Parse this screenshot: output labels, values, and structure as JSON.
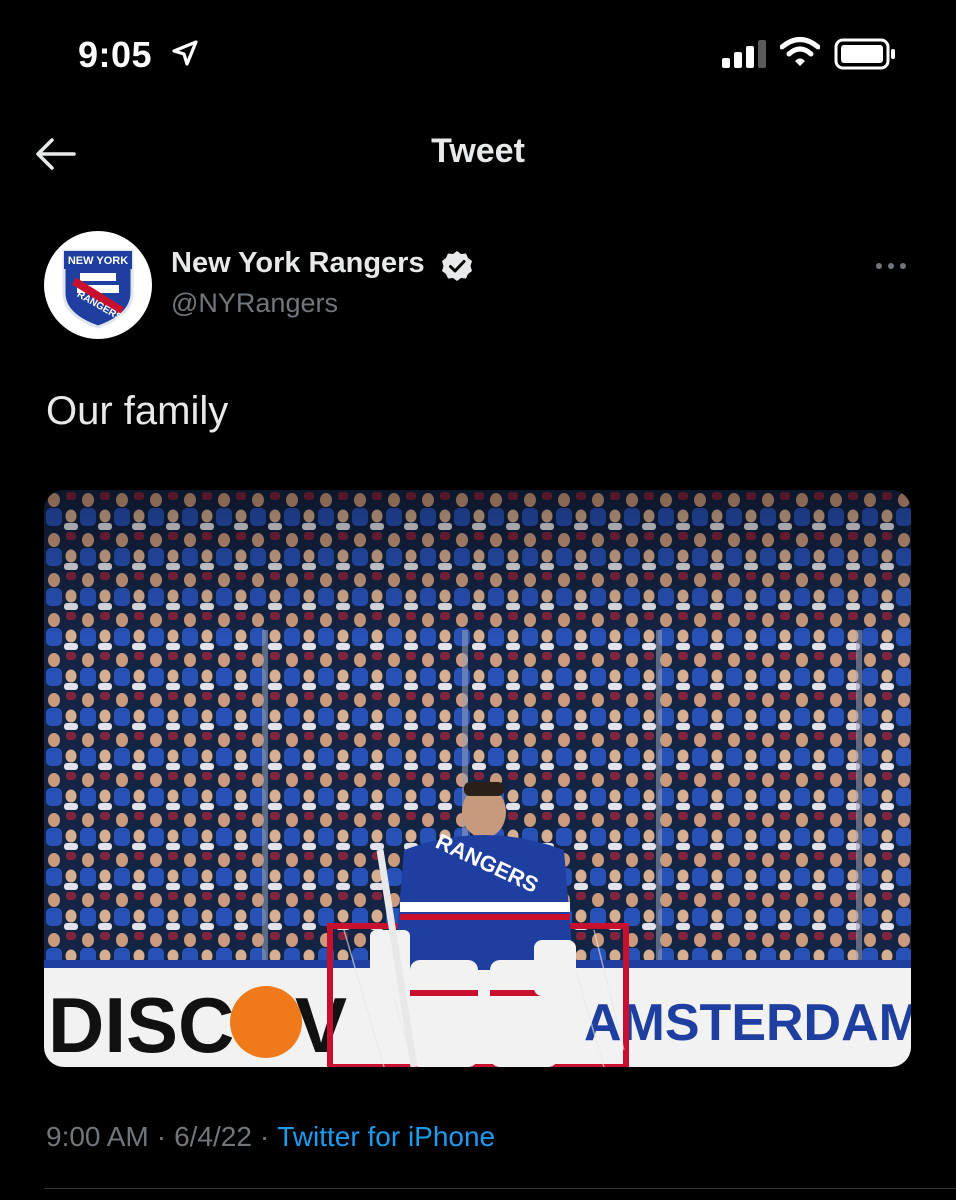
{
  "status_bar": {
    "time": "9:05",
    "icons": [
      "location-arrow-icon",
      "signal-icon",
      "wifi-icon",
      "battery-icon"
    ]
  },
  "header": {
    "title": "Tweet",
    "back_icon": "back-arrow-icon"
  },
  "tweet": {
    "author": {
      "name": "New York Rangers",
      "handle": "@NYRangers",
      "verified": true,
      "avatar_text_top": "NEW YORK",
      "avatar_text_bottom": "RANGERS"
    },
    "text": "Our family",
    "photo": {
      "jersey_text": "RANGERS",
      "boards_left": "DISCOV",
      "boards_right": "AMSTERDAM VODK"
    },
    "meta": {
      "time": "9:00 AM",
      "date": "6/4/22",
      "separator": "·",
      "source": "Twitter for iPhone"
    }
  },
  "colors": {
    "background": "#000000",
    "text_primary": "#e7e9ea",
    "text_secondary": "#71767b",
    "link": "#1d9bf0",
    "rangers_blue": "#1e3fa0",
    "rangers_red": "#c8102e"
  }
}
